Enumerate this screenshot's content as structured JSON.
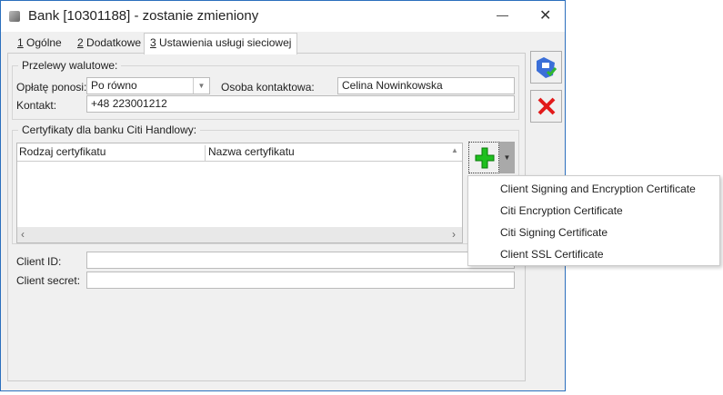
{
  "window": {
    "title": "Bank [10301188] - zostanie zmieniony",
    "minimize": "—",
    "close": "✕"
  },
  "tabs": [
    {
      "key": "1",
      "label": " Ogólne"
    },
    {
      "key": "2",
      "label": " Dodatkowe"
    },
    {
      "key": "3",
      "label": " Ustawienia usługi sieciowej"
    }
  ],
  "przelewy": {
    "legend": "Przelewy walutowe:",
    "oplata_label": "Opłatę ponosi:",
    "oplata_value": "Po równo",
    "osoba_label": "Osoba kontaktowa:",
    "osoba_value": "Celina Nowinkowska",
    "kontakt_label": "Kontakt:",
    "kontakt_value": "+48 223001212"
  },
  "certyfikaty": {
    "legend": "Certyfikaty dla banku Citi Handlowy:",
    "columns": [
      "Rodzaj certyfikatu",
      "Nazwa certyfikatu"
    ]
  },
  "menu": [
    "Client Signing and Encryption Certificate",
    "Citi Encryption Certificate",
    "Citi Signing Certificate",
    "Client SSL Certificate"
  ],
  "client": {
    "id_label": "Client ID:",
    "id_value": "",
    "secret_label": "Client secret:",
    "secret_value": ""
  }
}
